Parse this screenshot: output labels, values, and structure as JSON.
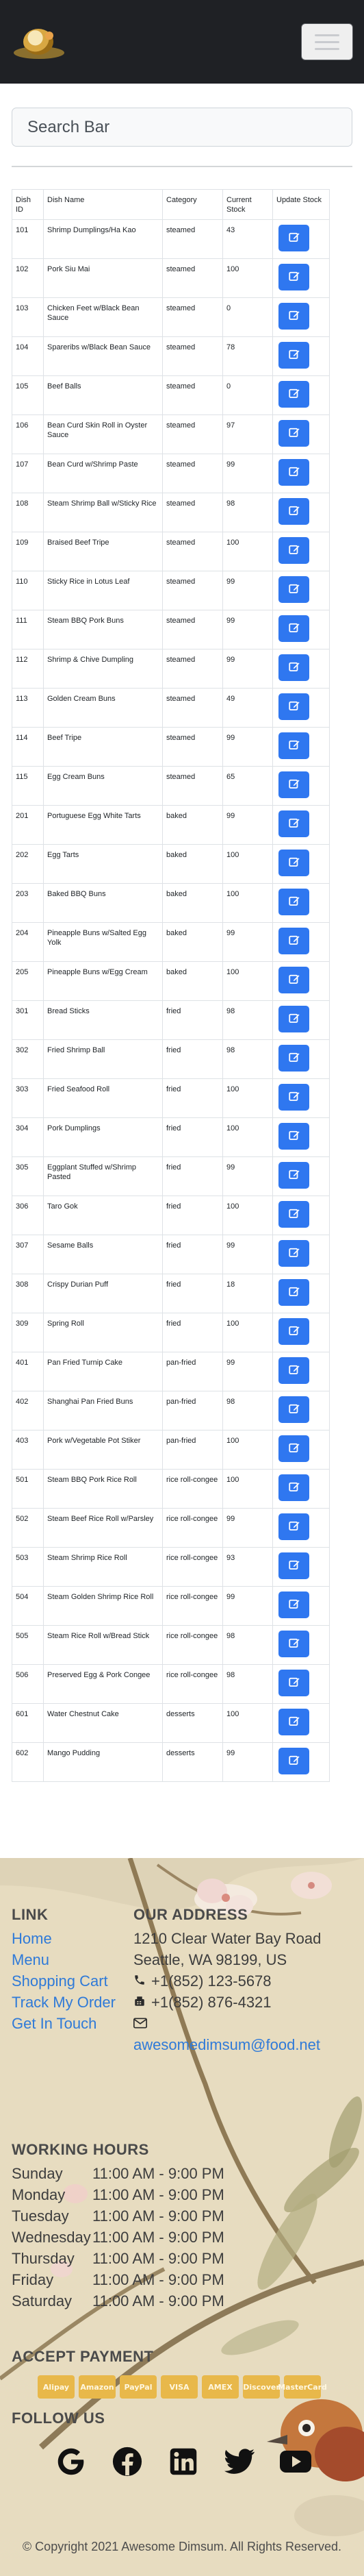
{
  "header": {
    "logo_icon": "dimsum-logo-icon",
    "menu_icon": "hamburger-menu-icon"
  },
  "search": {
    "placeholder": "Search Bar"
  },
  "table": {
    "columns": [
      "Dish ID",
      "Dish Name",
      "Category",
      "Current Stock",
      "Update Stock"
    ],
    "edit_icon": "edit-icon",
    "rows": [
      {
        "id": "101",
        "name": "Shrimp Dumplings/Ha Kao",
        "category": "steamed",
        "stock": "43"
      },
      {
        "id": "102",
        "name": "Pork Siu Mai",
        "category": "steamed",
        "stock": "100"
      },
      {
        "id": "103",
        "name": "Chicken Feet w/Black Bean Sauce",
        "category": "steamed",
        "stock": "0"
      },
      {
        "id": "104",
        "name": "Spareribs w/Black Bean Sauce",
        "category": "steamed",
        "stock": "78"
      },
      {
        "id": "105",
        "name": "Beef Balls",
        "category": "steamed",
        "stock": "0"
      },
      {
        "id": "106",
        "name": "Bean Curd Skin Roll in Oyster Sauce",
        "category": "steamed",
        "stock": "97"
      },
      {
        "id": "107",
        "name": "Bean Curd w/Shrimp Paste",
        "category": "steamed",
        "stock": "99"
      },
      {
        "id": "108",
        "name": "Steam Shrimp Ball w/Sticky Rice",
        "category": "steamed",
        "stock": "98"
      },
      {
        "id": "109",
        "name": "Braised Beef Tripe",
        "category": "steamed",
        "stock": "100"
      },
      {
        "id": "110",
        "name": "Sticky Rice in Lotus Leaf",
        "category": "steamed",
        "stock": "99"
      },
      {
        "id": "111",
        "name": "Steam BBQ Pork Buns",
        "category": "steamed",
        "stock": "99"
      },
      {
        "id": "112",
        "name": "Shrimp & Chive Dumpling",
        "category": "steamed",
        "stock": "99"
      },
      {
        "id": "113",
        "name": "Golden Cream Buns",
        "category": "steamed",
        "stock": "49"
      },
      {
        "id": "114",
        "name": "Beef Tripe",
        "category": "steamed",
        "stock": "99"
      },
      {
        "id": "115",
        "name": "Egg Cream Buns",
        "category": "steamed",
        "stock": "65"
      },
      {
        "id": "201",
        "name": "Portuguese Egg White Tarts",
        "category": "baked",
        "stock": "99"
      },
      {
        "id": "202",
        "name": "Egg Tarts",
        "category": "baked",
        "stock": "100"
      },
      {
        "id": "203",
        "name": "Baked BBQ Buns",
        "category": "baked",
        "stock": "100"
      },
      {
        "id": "204",
        "name": "Pineapple Buns w/Salted Egg Yolk",
        "category": "baked",
        "stock": "99"
      },
      {
        "id": "205",
        "name": "Pineapple Buns w/Egg Cream",
        "category": "baked",
        "stock": "100"
      },
      {
        "id": "301",
        "name": "Bread Sticks",
        "category": "fried",
        "stock": "98"
      },
      {
        "id": "302",
        "name": "Fried Shrimp Ball",
        "category": "fried",
        "stock": "98"
      },
      {
        "id": "303",
        "name": "Fried Seafood Roll",
        "category": "fried",
        "stock": "100"
      },
      {
        "id": "304",
        "name": "Pork Dumplings",
        "category": "fried",
        "stock": "100"
      },
      {
        "id": "305",
        "name": "Eggplant Stuffed w/Shrimp Pasted",
        "category": "fried",
        "stock": "99"
      },
      {
        "id": "306",
        "name": "Taro Gok",
        "category": "fried",
        "stock": "100"
      },
      {
        "id": "307",
        "name": "Sesame Balls",
        "category": "fried",
        "stock": "99"
      },
      {
        "id": "308",
        "name": "Crispy Durian Puff",
        "category": "fried",
        "stock": "18"
      },
      {
        "id": "309",
        "name": "Spring Roll",
        "category": "fried",
        "stock": "100"
      },
      {
        "id": "401",
        "name": "Pan Fried Turnip Cake",
        "category": "pan-fried",
        "stock": "99"
      },
      {
        "id": "402",
        "name": "Shanghai Pan Fried Buns",
        "category": "pan-fried",
        "stock": "98"
      },
      {
        "id": "403",
        "name": "Pork w/Vegetable Pot Stiker",
        "category": "pan-fried",
        "stock": "100"
      },
      {
        "id": "501",
        "name": "Steam BBQ Pork Rice Roll",
        "category": "rice roll-congee",
        "stock": "100"
      },
      {
        "id": "502",
        "name": "Steam Beef Rice Roll w/Parsley",
        "category": "rice roll-congee",
        "stock": "99"
      },
      {
        "id": "503",
        "name": "Steam Shrimp Rice Roll",
        "category": "rice roll-congee",
        "stock": "93"
      },
      {
        "id": "504",
        "name": "Steam Golden Shrimp Rice Roll",
        "category": "rice roll-congee",
        "stock": "99"
      },
      {
        "id": "505",
        "name": "Steam Rice Roll w/Bread Stick",
        "category": "rice roll-congee",
        "stock": "98"
      },
      {
        "id": "506",
        "name": "Preserved Egg & Pork Congee",
        "category": "rice roll-congee",
        "stock": "98"
      },
      {
        "id": "601",
        "name": "Water Chestnut Cake",
        "category": "desserts",
        "stock": "100"
      },
      {
        "id": "602",
        "name": "Mango Pudding",
        "category": "desserts",
        "stock": "99"
      }
    ]
  },
  "footer": {
    "link_heading": "LINK",
    "links": [
      "Home",
      "Menu",
      "Shopping Cart",
      "Track My Order",
      "Get In Touch"
    ],
    "address_heading": "OUR ADDRESS",
    "address_line1": "1210 Clear Water Bay Road",
    "address_line2": "Seattle, WA 98199, US",
    "phone": "+1(852) 123-5678",
    "fax": "+1(852) 876-4321",
    "email": "awesomedimsum@food.net",
    "hours_heading": "WORKING HOURS",
    "hours": [
      {
        "day": "Sunday",
        "time": "11:00 AM - 9:00 PM"
      },
      {
        "day": "Monday",
        "time": "11:00 AM - 9:00 PM"
      },
      {
        "day": "Tuesday",
        "time": "11:00 AM - 9:00 PM"
      },
      {
        "day": "Wednesday",
        "time": "11:00 AM - 9:00 PM"
      },
      {
        "day": "Thursday",
        "time": "11:00 AM - 9:00 PM"
      },
      {
        "day": "Friday",
        "time": "11:00 AM - 9:00 PM"
      },
      {
        "day": "Saturday",
        "time": "11:00 AM - 9:00 PM"
      }
    ],
    "payment_heading": "ACCEPT PAYMENT",
    "payment_methods": [
      "Alipay",
      "Amazon",
      "PayPal",
      "VISA",
      "AMEX",
      "Discover",
      "MasterCard"
    ],
    "follow_heading": "FOLLOW US",
    "socials": [
      "google-icon",
      "facebook-icon",
      "linkedin-icon",
      "twitter-icon",
      "youtube-icon"
    ],
    "copyright": "© Copyright 2021 Awesome Dimsum. All Rights Reserved."
  },
  "colors": {
    "navbar": "#1f2125",
    "button": "#2f77f0",
    "link": "#2f7ad8",
    "footer_bg": "#e7dcc0",
    "payment_card": "#e8b84a"
  }
}
